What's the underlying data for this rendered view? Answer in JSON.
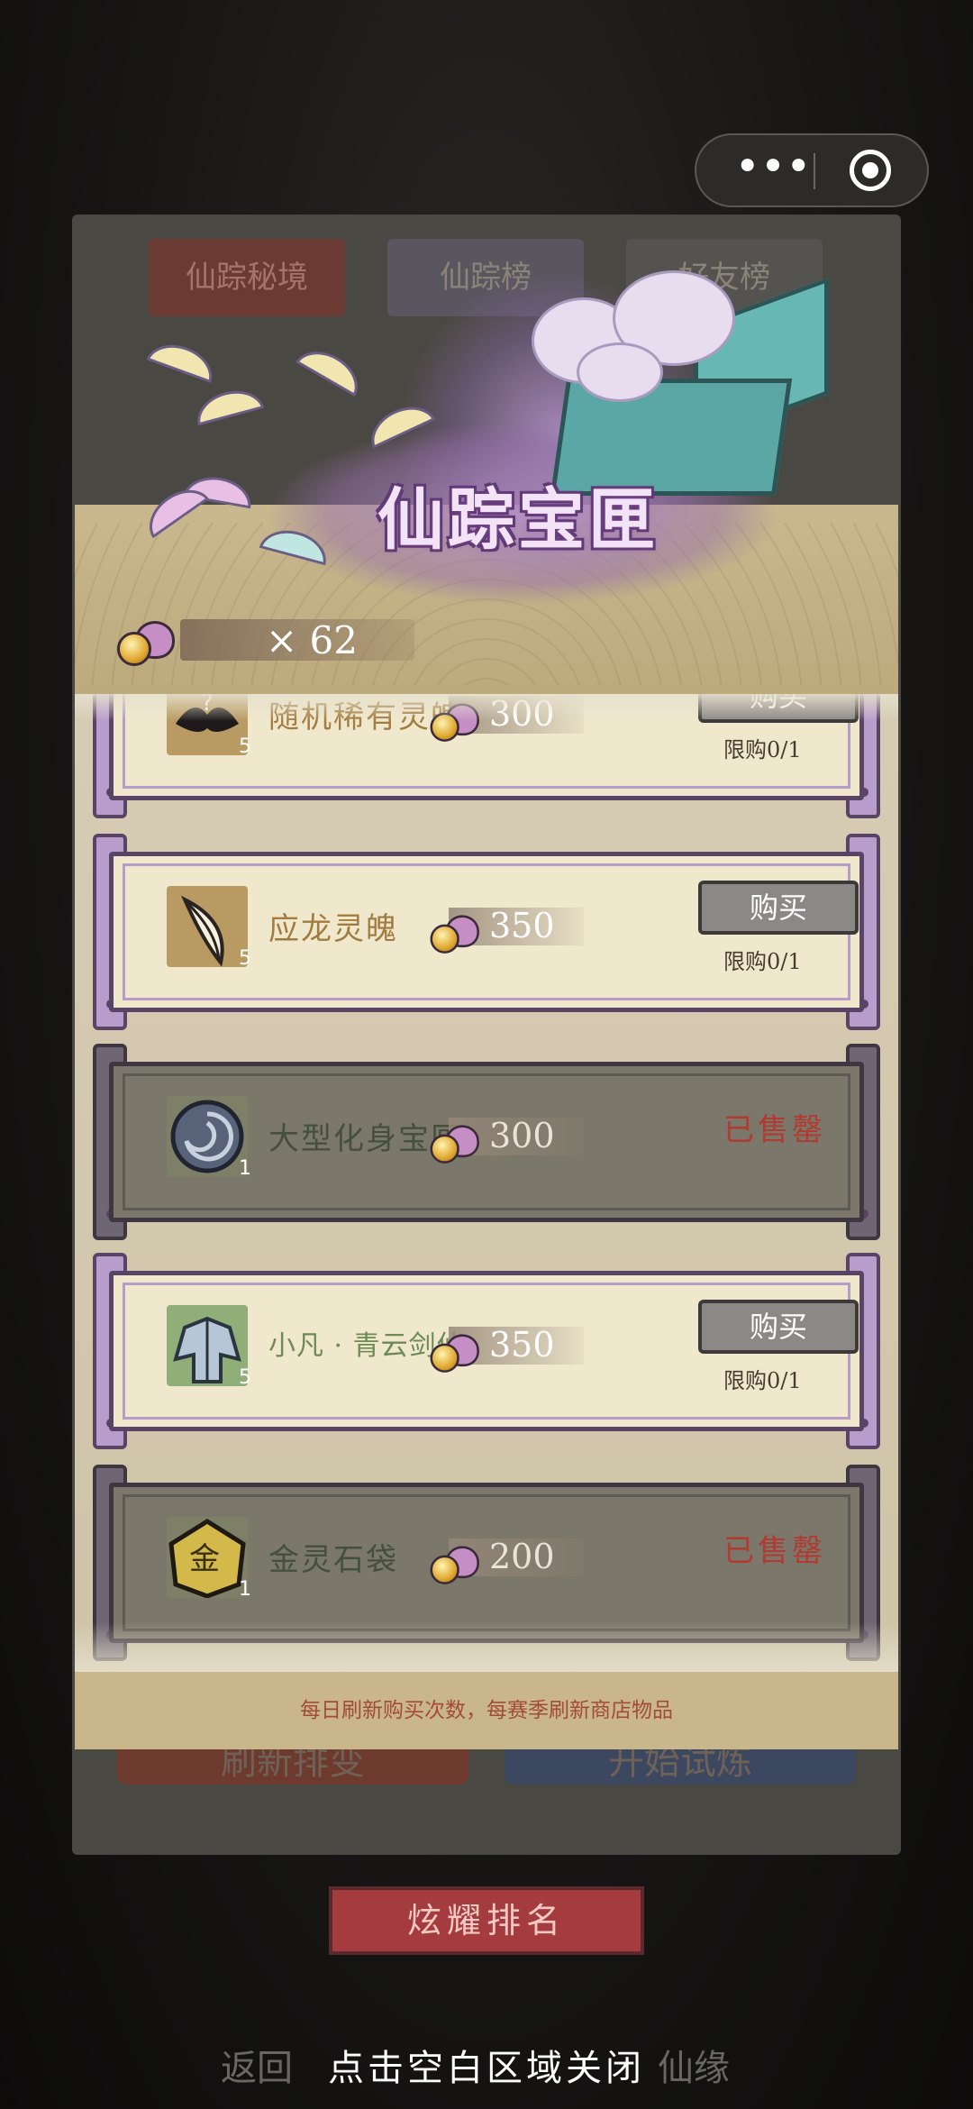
{
  "capsule": {
    "more_glyph": "•••",
    "more_icon": "more-dots-icon",
    "close_icon": "target-circle-icon"
  },
  "tabs": [
    "仙踪秘境",
    "仙踪榜",
    "好友榜"
  ],
  "under_buttons": {
    "left": "刷新排变",
    "right": "开始试炼"
  },
  "shop": {
    "title": "仙踪宝匣",
    "currency": {
      "icon": "spirit-pouch-icon",
      "amount": "× 62"
    },
    "items": [
      {
        "name": "随机稀有灵魄",
        "qty": "5",
        "price": "300",
        "state": "buy",
        "buy_label": "购买",
        "limit": "限购0/1",
        "icon": "mystery-bird-icon"
      },
      {
        "name": "应龙灵魄",
        "qty": "5",
        "price": "350",
        "state": "buy",
        "buy_label": "购买",
        "limit": "限购0/1",
        "icon": "feather-icon"
      },
      {
        "name": "大型化身宝匣",
        "qty": "1",
        "price": "300",
        "state": "sold",
        "sold_label": "已售罄",
        "icon": "swirl-orb-icon"
      },
      {
        "name": "小凡 · 青云剑仙",
        "qty": "5",
        "price": "350",
        "state": "buy",
        "buy_label": "购买",
        "limit": "限购0/1",
        "icon": "robe-icon"
      },
      {
        "name": "金灵石袋",
        "qty": "1",
        "price": "200",
        "state": "sold",
        "sold_label": "已售罄",
        "icon": "gold-stone-bag-icon"
      }
    ],
    "footer": "每日刷新购买次数，每赛季刷新商店物品"
  },
  "bottom": {
    "rank_button": "炫耀排名",
    "back_label": "返回",
    "fate_label": "仙缘",
    "close_hint": "点击空白区域关闭"
  }
}
